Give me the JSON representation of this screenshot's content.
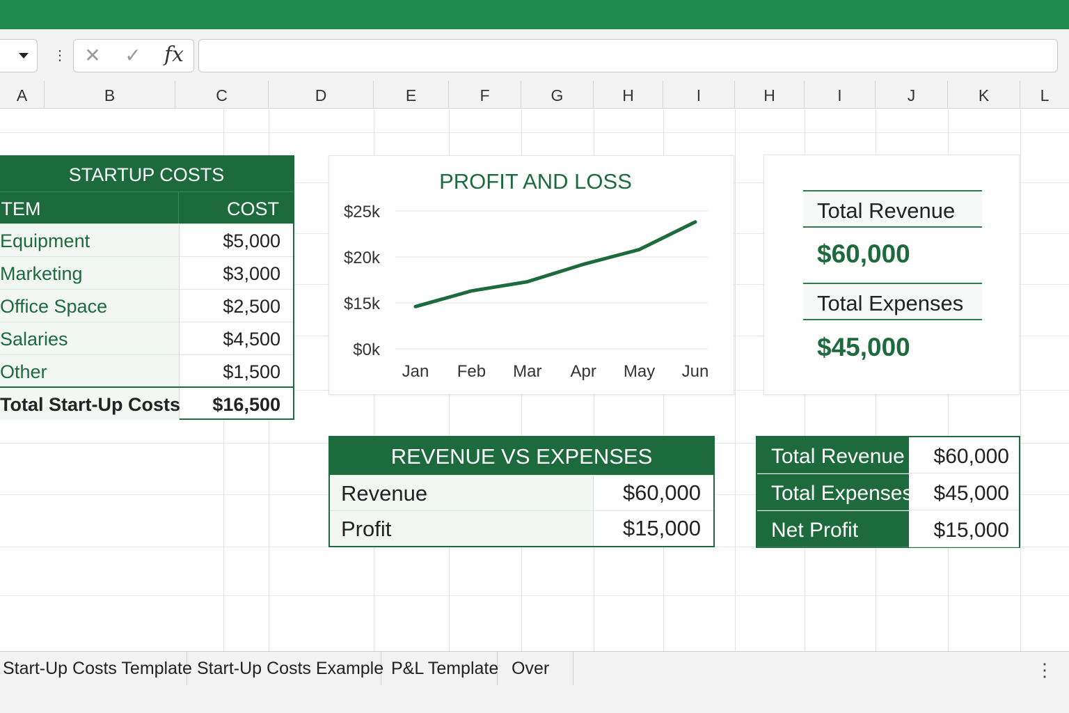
{
  "theme": {
    "accent": "#1d6a3c",
    "titlebar": "#1f8a4c"
  },
  "formula_bar": {
    "cancel_icon": "close-icon",
    "enter_icon": "check-icon",
    "fx_label": "fx",
    "formula_value": ""
  },
  "columns": [
    "A",
    "B",
    "C",
    "D",
    "E",
    "F",
    "G",
    "H",
    "I",
    "H",
    "I",
    "J",
    "K",
    "L"
  ],
  "startup_costs": {
    "title": "STARTUP COSTS",
    "headers": {
      "item": "ITEM",
      "cost": "COST"
    },
    "rows": [
      {
        "item": "Equipment",
        "cost": "$5,000"
      },
      {
        "item": "Marketing",
        "cost": "$3,000"
      },
      {
        "item": "Office Space",
        "cost": "$2,500"
      },
      {
        "item": "Salaries",
        "cost": "$4,500"
      },
      {
        "item": "Other",
        "cost": "$1,500"
      }
    ],
    "total": {
      "label": "Total Start-Up Costs",
      "value": "$16,500"
    }
  },
  "chart_data": {
    "type": "line",
    "title": "PROFIT AND LOSS",
    "categories": [
      "Jan",
      "Feb",
      "Mar",
      "Apr",
      "May",
      "Jun"
    ],
    "y_ticks": [
      "$25k",
      "$20k",
      "$15k",
      "$0k"
    ],
    "series": [
      {
        "values": [
          13.8,
          16.3,
          17.3,
          19.2,
          20.8,
          23.8
        ]
      }
    ],
    "color": "#1d6a3c",
    "xlabel": "",
    "ylabel": "",
    "grid": true,
    "note": "y axis nonlinear as drawn: ticks at 25k, 20k, 15k, 0k"
  },
  "kpi_card": {
    "revenue_label": "Total Revenue",
    "revenue_value": "$60,000",
    "expenses_label": "Total Expenses",
    "expenses_value": "$45,000"
  },
  "revenue_vs_expenses": {
    "title": "REVENUE VS EXPENSES",
    "rows": [
      {
        "label": "Revenue",
        "value": "$60,000"
      },
      {
        "label": "Profit",
        "value": "$15,000"
      }
    ]
  },
  "summary": {
    "rows": [
      {
        "label": "Total Revenue",
        "value": "$60,000"
      },
      {
        "label": "Total Expenses",
        "value": "$45,000"
      },
      {
        "label": "Net Profit",
        "value": "$15,000"
      }
    ]
  },
  "sheet_tabs": [
    "Start-Up Costs Template",
    "Start-Up Costs Example",
    "P&L Template",
    "Over"
  ]
}
